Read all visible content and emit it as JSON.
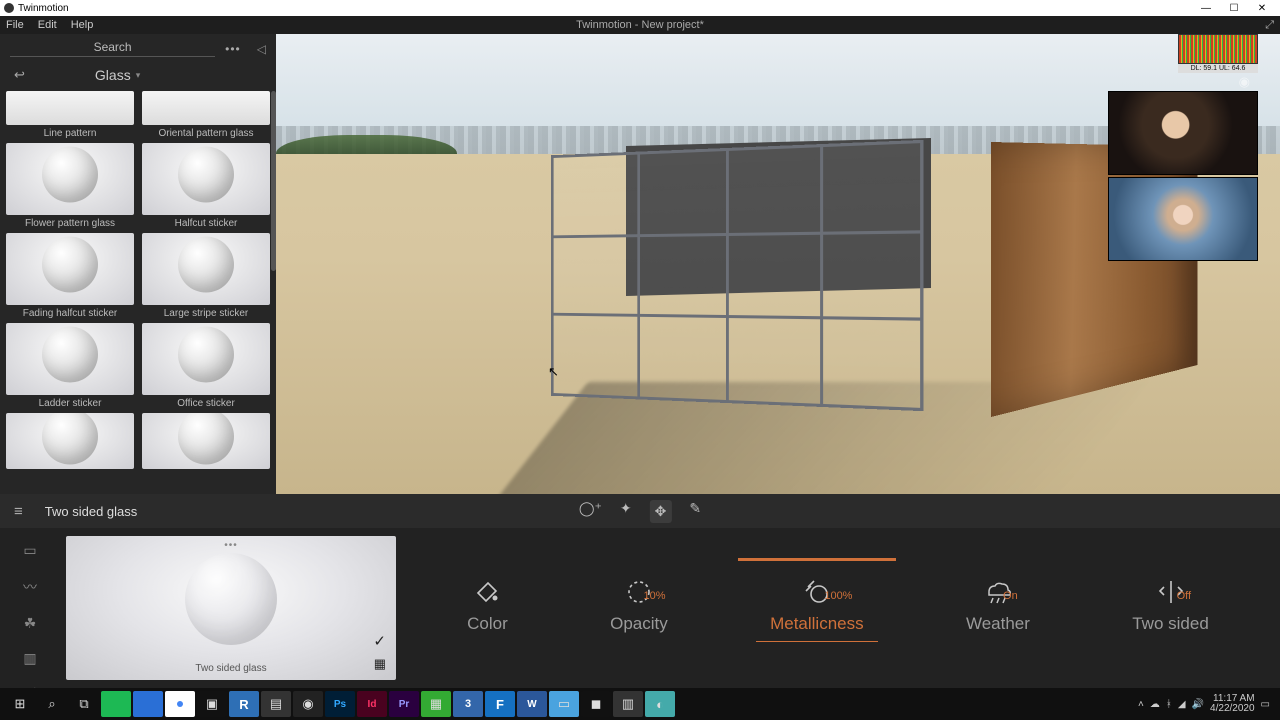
{
  "window": {
    "app_name": "Twinmotion",
    "doc_title": "Twinmotion - New project*"
  },
  "menubar": {
    "file": "File",
    "edit": "Edit",
    "help": "Help"
  },
  "sidebar": {
    "search_placeholder": "Search",
    "category": "Glass",
    "thumbs": [
      {
        "label": "Line pattern"
      },
      {
        "label": "Oriental pattern glass"
      },
      {
        "label": "Flower pattern glass"
      },
      {
        "label": "Halfcut sticker"
      },
      {
        "label": "Fading halfcut sticker"
      },
      {
        "label": "Large stripe sticker"
      },
      {
        "label": "Ladder sticker"
      },
      {
        "label": "Office sticker"
      },
      {
        "label": ""
      },
      {
        "label": ""
      }
    ]
  },
  "perf": {
    "readout": "DL: 59.1 UL: 64.6"
  },
  "dock": {
    "selected_material": "Two sided glass"
  },
  "preview": {
    "label": "Two sided glass"
  },
  "attrs": {
    "color": {
      "label": "Color"
    },
    "opacity": {
      "label": "Opacity",
      "value": "10%"
    },
    "metallicness": {
      "label": "Metallicness",
      "value": "100%"
    },
    "weather": {
      "label": "Weather",
      "value": "On"
    },
    "two_sided": {
      "label": "Two sided",
      "value": "Off"
    }
  },
  "tray": {
    "time": "11:17 AM",
    "date": "4/22/2020"
  }
}
